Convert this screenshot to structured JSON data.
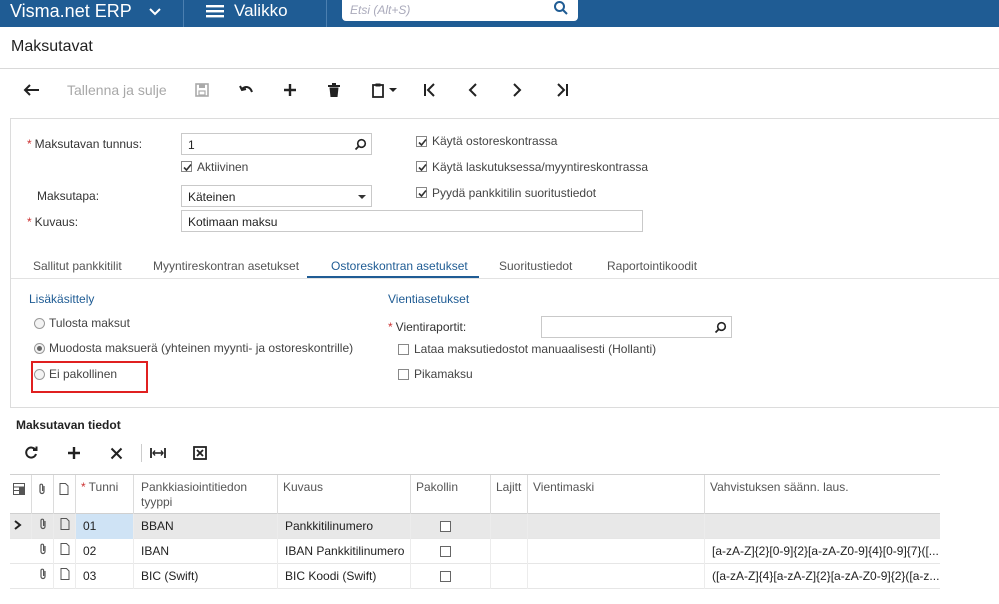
{
  "topbar": {
    "app_name": "Visma.net ERP",
    "menu_label": "Valikko",
    "search_placeholder": "Etsi (Alt+S)"
  },
  "page": {
    "title": "Maksutavat"
  },
  "toolbar": {
    "save_close_label": "Tallenna ja sulje"
  },
  "form": {
    "id_label": "Maksutavan tunnus:",
    "id_value": "1",
    "active_label": "Aktiivinen",
    "method_label": "Maksutapa:",
    "method_value": "Käteinen",
    "desc_label": "Kuvaus:",
    "desc_value": "Kotimaan maksu",
    "cb_ap_label": "Käytä ostoreskontrassa",
    "cb_ar_label": "Käytä laskutuksessa/myyntireskontrassa",
    "cb_bank_label": "Pyydä pankkitilin suoritustiedot"
  },
  "tabs": [
    {
      "label": "Sallitut pankkitilit"
    },
    {
      "label": "Myyntireskontran asetukset"
    },
    {
      "label": "Ostoreskontran asetukset"
    },
    {
      "label": "Suoritustiedot"
    },
    {
      "label": "Raportointikoodit"
    }
  ],
  "processing": {
    "title": "Lisäkäsittely",
    "opt_print": "Tulosta maksut",
    "opt_batch": "Muodosta maksuerä (yhteinen myynti- ja ostoreskontrille)",
    "opt_none": "Ei pakollinen"
  },
  "export": {
    "title": "Vientiasetukset",
    "reports_label": "Vientiraportit:",
    "manual_label": "Lataa maksutiedostot manuaalisesti (Hollanti)",
    "quick_label": "Pikamaksu"
  },
  "details": {
    "title": "Maksutavan tiedot",
    "columns": {
      "id": "Tunni",
      "type_line1": "Pankkiasiointitiedon",
      "type_line2": "tyyppi",
      "desc": "Kuvaus",
      "required": "Pakollin",
      "sort": "Lajitt",
      "mask": "Vientimaski",
      "regex": "Vahvistuksen säänn. laus."
    },
    "rows": [
      {
        "id": "01",
        "type": "BBAN",
        "desc": "Pankkitilinumero",
        "regex": ""
      },
      {
        "id": "02",
        "type": "IBAN",
        "desc": "IBAN Pankkitilinumero",
        "regex": "[a-zA-Z]{2}[0-9]{2}[a-zA-Z0-9]{4}[0-9]{7}([..."
      },
      {
        "id": "03",
        "type": "BIC (Swift)",
        "desc": "BIC Koodi (Swift)",
        "regex": "([a-zA-Z]{4}[a-zA-Z]{2}[a-zA-Z0-9]{2}([a-z..."
      }
    ]
  },
  "colors": {
    "brand": "#1f5c94",
    "highlight": "#e02020"
  }
}
